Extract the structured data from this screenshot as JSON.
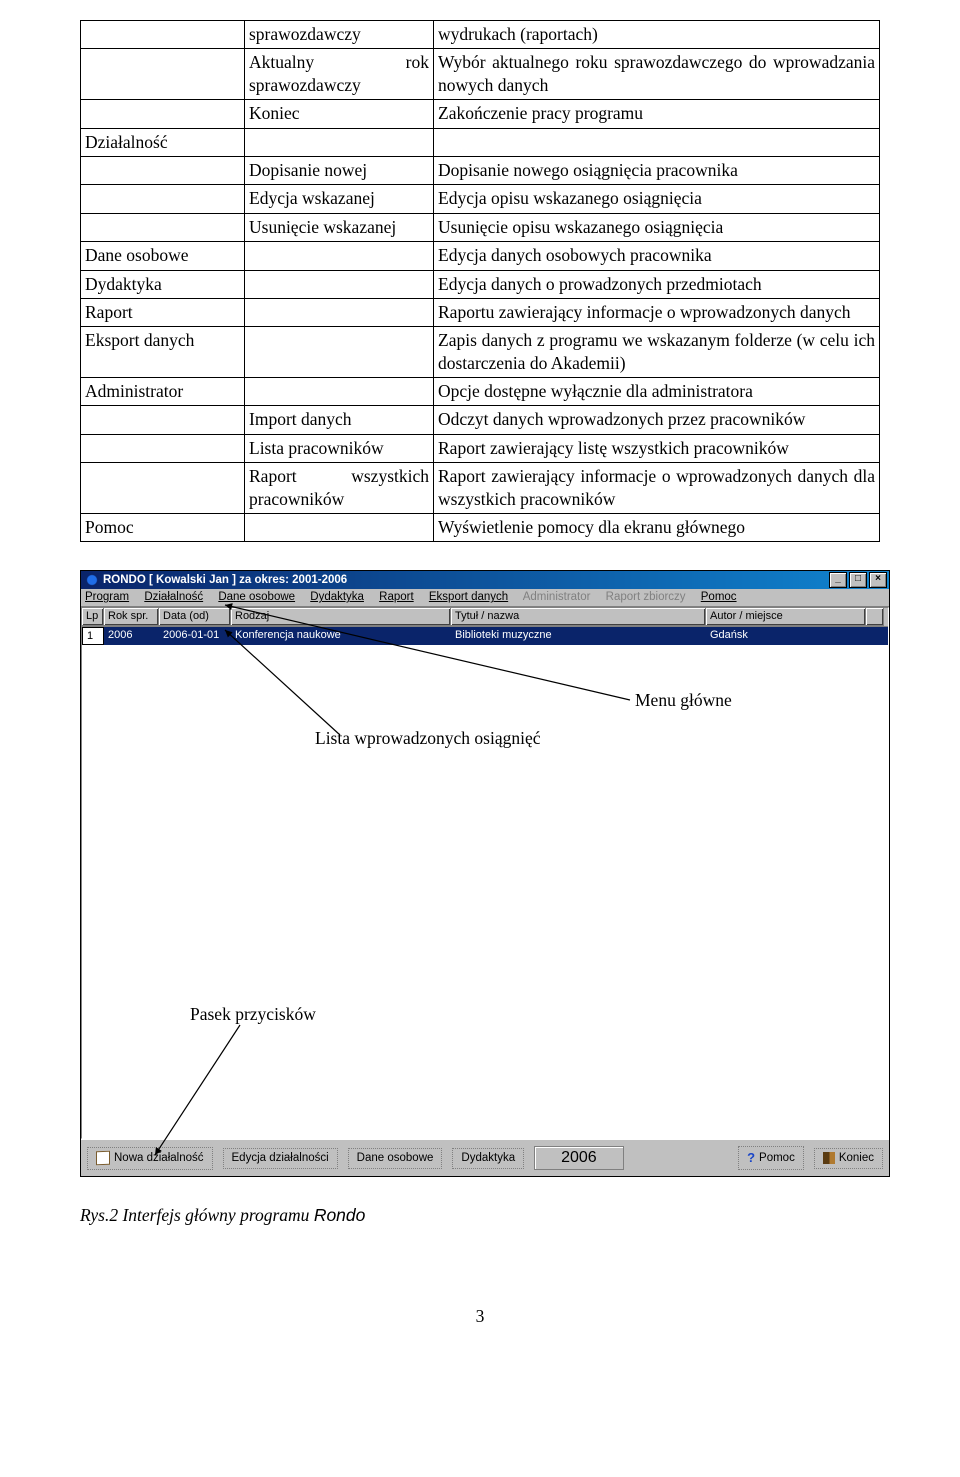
{
  "table_rows": [
    {
      "c1": "",
      "c2": "sprawozdawczy",
      "c3": "wydrukach (raportach)"
    },
    {
      "c1": "",
      "c2": "Aktualny rok sprawozdawczy",
      "c3": "Wybór aktualnego roku sprawozdawczego do wprowadzania nowych danych"
    },
    {
      "c1": "",
      "c2": "Koniec",
      "c3": "Zakończenie pracy programu"
    },
    {
      "c1": "Działalność",
      "c2": "",
      "c3": ""
    },
    {
      "c1": "",
      "c2": "Dopisanie nowej",
      "c3": "Dopisanie nowego osiągnięcia pracownika"
    },
    {
      "c1": "",
      "c2": "Edycja wskazanej",
      "c3": "Edycja opisu wskazanego osiągnięcia"
    },
    {
      "c1": "",
      "c2": "Usunięcie wskazanej",
      "c3": "Usunięcie opisu wskazanego osiągnięcia"
    },
    {
      "c1": "Dane osobowe",
      "c2": "",
      "c3": "Edycja danych osobowych pracownika"
    },
    {
      "c1": "Dydaktyka",
      "c2": "",
      "c3": "Edycja danych o prowadzonych przedmiotach"
    },
    {
      "c1": "Raport",
      "c2": "",
      "c3": "Raportu zawierający informacje o wprowadzonych danych"
    },
    {
      "c1": "Eksport danych",
      "c2": "",
      "c3": "Zapis danych z programu we wskazanym folderze (w celu ich dostarczenia do Akademii)"
    },
    {
      "c1": "Administrator",
      "c2": "",
      "c3": "Opcje dostępne wyłącznie dla administratora"
    },
    {
      "c1": "",
      "c2": "Import danych",
      "c3": "Odczyt danych wprowadzonych przez pracowników"
    },
    {
      "c1": "",
      "c2": "Lista pracowników",
      "c3": "Raport zawierający listę wszystkich pracowników"
    },
    {
      "c1": "",
      "c2": "Raport wszystkich pracowników",
      "c3": "Raport zawierający informacje o wprowadzonych danych dla wszystkich pracowników"
    },
    {
      "c1": "Pomoc",
      "c2": "",
      "c3": "Wyświetlenie pomocy dla ekranu głównego"
    }
  ],
  "screenshot": {
    "title": "RONDO [ Kowalski Jan ] za okres: 2001-2006",
    "minimize": "_",
    "maximize": "□",
    "close": "×",
    "menu": {
      "program": "Program",
      "dzialalnosc": "Działalność",
      "dane_osobowe": "Dane osobowe",
      "dydaktyka": "Dydaktyka",
      "raport": "Raport",
      "eksport": "Eksport danych",
      "administrator": "Administrator",
      "raport_zbiorczy": "Raport zbiorczy",
      "pomoc": "Pomoc"
    },
    "headers": {
      "lp": "Lp",
      "rok": "Rok spr.",
      "data": "Data (od)",
      "rodzaj": "Rodzaj",
      "tytul": "Tytuł / nazwa",
      "autor": "Autor / miejsce"
    },
    "row": {
      "lp": "1",
      "rok": "2006",
      "data": "2006-01-01",
      "rodzaj": "Konferencja naukowe",
      "tytul": "Biblioteki muzyczne",
      "autor": "Gdańsk"
    },
    "buttons": {
      "nowa": "Nowa działalność",
      "edycja": "Edycja działalności",
      "dane_osobowe": "Dane osobowe",
      "dydaktyka": "Dydaktyka",
      "pomoc": "Pomoc",
      "koniec": "Koniec"
    },
    "year": "2006"
  },
  "annotations": {
    "menu_glowne": "Menu główne",
    "lista": "Lista wprowadzonych osiągnięć",
    "pasek": "Pasek przycisków"
  },
  "caption_prefix": "Rys.2 Interfejs główny programu ",
  "caption_app": "Rondo",
  "page_number": "3"
}
